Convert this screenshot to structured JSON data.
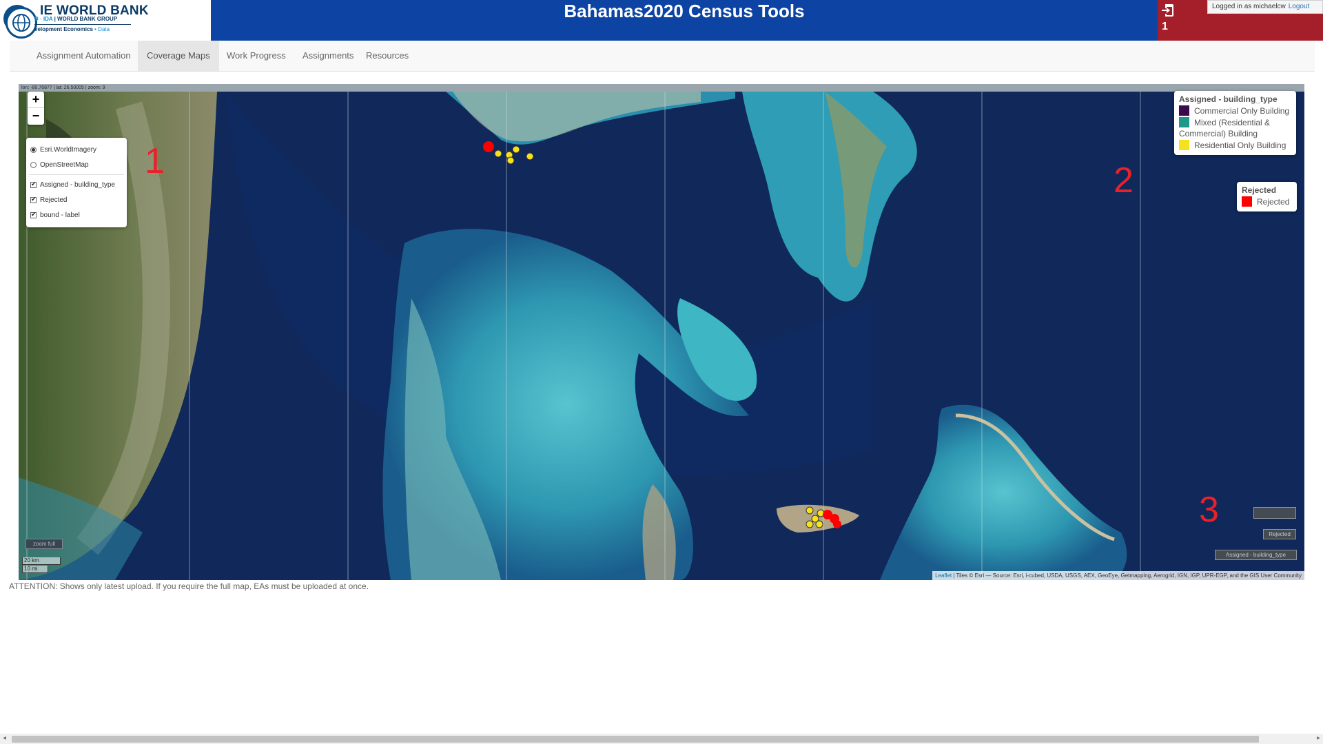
{
  "header": {
    "logo_title": "IE WORLD BANK",
    "logo_sub_ibrd": "D · IDA",
    "logo_sub_group": " | WORLD BANK GROUP",
    "logo_dev": "velopment Economics",
    "logo_data": " • Data",
    "app_title": "Bahamas2020 Census Tools",
    "notification_count": "1",
    "logged_in_text": "Logged in as michaelcw",
    "logout_label": "Logout",
    "colors": {
      "title_band": "#0d44a3",
      "user_band": "#a41f2a"
    }
  },
  "nav": {
    "items": [
      {
        "label": "Assignment Automation",
        "active": false
      },
      {
        "label": "Coverage Maps",
        "active": true
      },
      {
        "label": "Work Progress",
        "active": false
      },
      {
        "label": "Assignments",
        "active": false
      },
      {
        "label": "Resources",
        "active": false
      }
    ]
  },
  "map": {
    "coords_text": "lon: -80.76877 | lat: 26.50005 | zoom: 9",
    "zoom_in": "+",
    "zoom_out": "−",
    "base_layers": [
      {
        "label": "Esri.WorldImagery",
        "selected": true
      },
      {
        "label": "OpenStreetMap",
        "selected": false
      }
    ],
    "overlays": [
      {
        "label": "Assigned - building_type",
        "checked": true
      },
      {
        "label": "Rejected",
        "checked": true
      },
      {
        "label": "bound - label",
        "checked": true
      }
    ],
    "annotations": [
      "1",
      "2",
      "3"
    ],
    "legend_building": {
      "title": "Assigned - building_type",
      "items": [
        {
          "label": "Commercial Only Building",
          "color": "#3b0a4f"
        },
        {
          "label": "Mixed (Residential & Commercial) Building",
          "color": "#1f9a8a"
        },
        {
          "label": "Residential Only Building",
          "color": "#f5e21d"
        }
      ]
    },
    "legend_rejected": {
      "title": "Rejected",
      "items": [
        {
          "label": "Rejected",
          "color": "#ff0000"
        }
      ]
    },
    "mini_buttons": [
      "Rejected",
      "Assigned - building_type"
    ],
    "zoom_full_label": "zoom full",
    "scale_km": "20 km",
    "scale_mi": "10 mi",
    "attribution_leaflet": "Leaflet",
    "attribution_rest": " | Tiles © Esri — Source: Esri, i-cubed, USDA, USGS, AEX, GeoEye, Getmapping, Aerogrid, IGN, IGP, UPR-EGP, and the GIS User Community",
    "colors": {
      "deep_water": "#0d2350",
      "shallow_water": "#3aa7b8",
      "land": "#5d6e3c"
    }
  },
  "footer": {
    "attention": "ATTENTION: Shows only latest upload. If you require the full map, EAs must be uploaded at once."
  }
}
